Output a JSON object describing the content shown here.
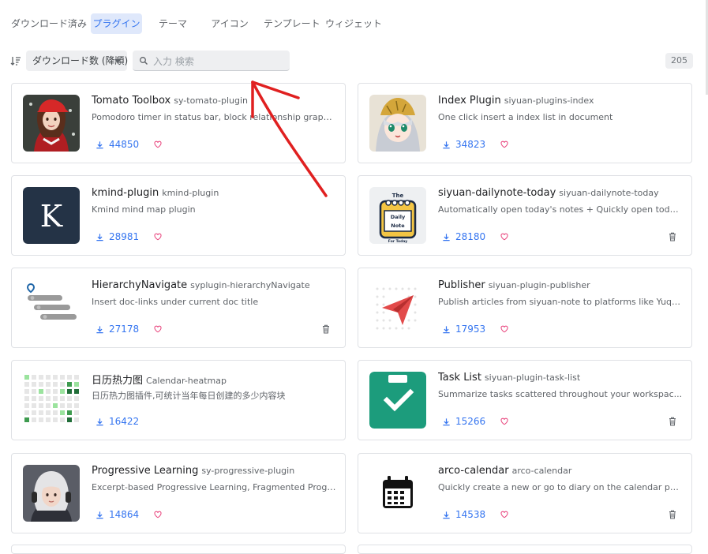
{
  "tabs": [
    {
      "label": "ダウンロード済み"
    },
    {
      "label": "プラグイン"
    },
    {
      "label": "テーマ"
    },
    {
      "label": "アイコン"
    },
    {
      "label": "テンプレート"
    },
    {
      "label": "ウィジェット"
    }
  ],
  "active_tab": "プラグイン",
  "toolbar": {
    "sort_icon": "sort-descending-icon",
    "sort_label": "ダウンロード数 (降順)",
    "search_placeholder": "入力 検索",
    "total_count": "205"
  },
  "plugins": [
    {
      "name": "Tomato Toolbox",
      "package": "sy-tomato-plugin",
      "description": "Pomodoro timer in status bar, block relationship graph...",
      "downloads": "44850",
      "thumb": "girl-red-cap-avatar",
      "trash": false
    },
    {
      "name": "Index Plugin",
      "package": "siyuan-plugins-index",
      "description": "One click insert a index list in document",
      "downloads": "34823",
      "thumb": "anime-girl-avatar",
      "trash": false
    },
    {
      "name": "kmind-plugin",
      "package": "kmind-plugin",
      "description": "Kmind mind map plugin",
      "downloads": "28981",
      "thumb": "letter-k-logo",
      "trash": false
    },
    {
      "name": "siyuan-dailynote-today",
      "package": "siyuan-dailynote-today",
      "description": "Automatically open today's notes + Quickly open toda...",
      "downloads": "28180",
      "thumb": "daily-note-logo",
      "trash": true
    },
    {
      "name": "HierarchyNavigate",
      "package": "syplugin-hierarchyNavigate",
      "description": "Insert doc-links under current doc title",
      "downloads": "27178",
      "thumb": "hierarchy-logo",
      "trash": true
    },
    {
      "name": "Publisher",
      "package": "siyuan-plugin-publisher",
      "description": "Publish articles from siyuan-note to platforms like Yuqu...",
      "downloads": "17953",
      "thumb": "paper-plane-logo",
      "trash": false
    },
    {
      "name": "日历热力图",
      "package": "Calendar-heatmap",
      "description": "日历热力图插件,可统计当年每日创建的多少内容块",
      "downloads": "16422",
      "thumb": "heatmap-logo",
      "trash": false
    },
    {
      "name": "Task List",
      "package": "siyuan-plugin-task-list",
      "description": "Summarize tasks scattered throughout your workspac...",
      "downloads": "15266",
      "thumb": "task-list-logo",
      "trash": true
    },
    {
      "name": "Progressive Learning",
      "package": "sy-progressive-plugin",
      "description": "Excerpt-based Progressive Learning, Fragmented Progr...",
      "downloads": "14864",
      "thumb": "girl-headphones-avatar",
      "trash": false
    },
    {
      "name": "arco-calendar",
      "package": "arco-calendar",
      "description": "Quickly create a new or go to diary on the calendar pa...",
      "downloads": "14538",
      "thumb": "calendar-logo",
      "trash": true
    }
  ],
  "colors": {
    "accent": "#3575f0",
    "heart": "#e8407a",
    "annotation": "#e02020"
  }
}
